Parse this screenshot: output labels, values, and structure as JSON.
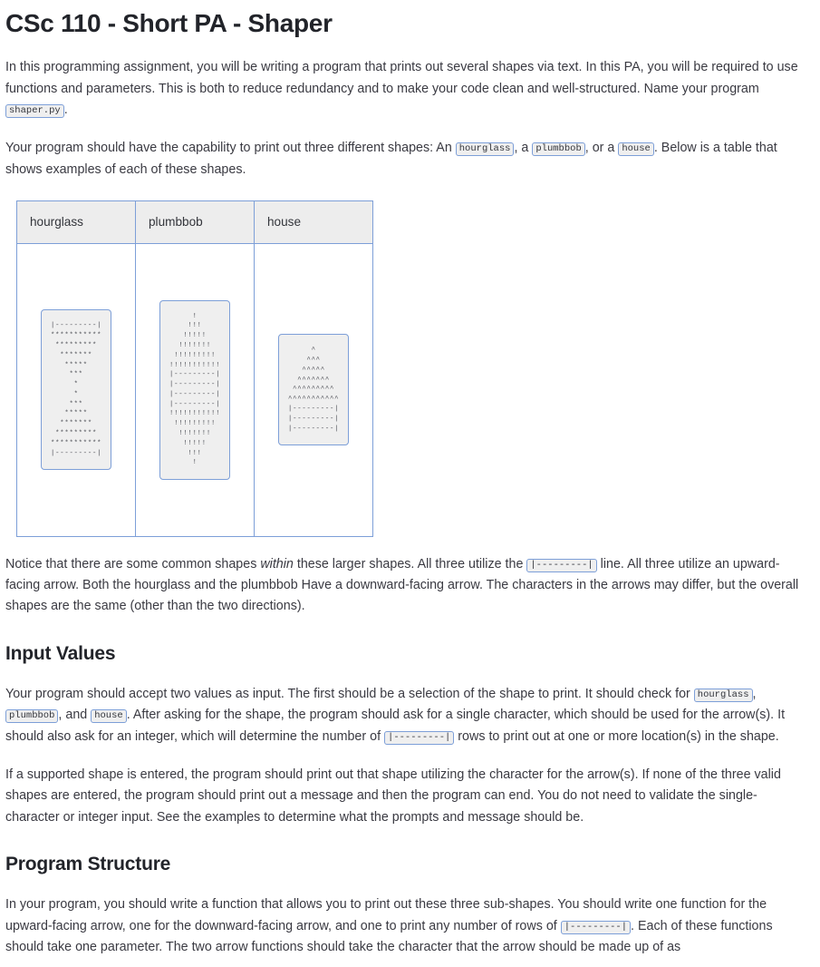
{
  "document": {
    "title": "CSc 110 - Short PA - Shaper"
  },
  "intro": {
    "p1_a": "In this programming assignment, you will be writing a program that prints out several shapes via text. In this PA, you will be required to use functions and parameters. This is both to reduce redundancy and to make your code clean and well-structured. Name your program ",
    "p1_code": "shaper.py",
    "p1_b": ".",
    "p2_a": "Your program should have the capability to print out three different shapes: An ",
    "p2_code1": "hourglass",
    "p2_b": ", a ",
    "p2_code2": "plumbbob",
    "p2_c": ", or a ",
    "p2_code3": "house",
    "p2_d": ". Below is a table that shows examples of each of these shapes."
  },
  "table": {
    "headers": [
      "hourglass",
      "plumbbob",
      "house"
    ],
    "shapes": {
      "hourglass": "|---------|\n***********\n *********\n  *******\n   *****\n    ***\n     *\n     *\n    ***\n   *****\n  *******\n *********\n***********\n|---------|",
      "plumbbob": "     !\n    !!!\n   !!!!!\n  !!!!!!!\n !!!!!!!!!\n!!!!!!!!!!!\n|---------|\n|---------|\n|---------|\n|---------|\n!!!!!!!!!!!\n !!!!!!!!!\n  !!!!!!!\n   !!!!!\n    !!!\n     !",
      "house": "     ^\n    ^^^\n   ^^^^^\n  ^^^^^^^\n ^^^^^^^^^\n^^^^^^^^^^^\n|---------|\n|---------|\n|---------|"
    }
  },
  "notice": {
    "a": "Notice that there are some common shapes ",
    "italic": "within",
    "b": " these larger shapes. All three utilize the ",
    "code": "|---------|",
    "c": " line. All three utilize an upward-facing arrow. Both the hourglass and the plumbbob Have a downward-facing arrow. The characters in the arrows may differ, but the overall shapes are the same (other than the two directions)."
  },
  "input_values": {
    "heading": "Input Values",
    "p1_a": "Your program should accept two values as input. The first should be a selection of the shape to print. It should check for ",
    "p1_code1": "hourglass",
    "p1_b": ", ",
    "p1_code2": "plumbbob",
    "p1_c": ", and ",
    "p1_code3": "house",
    "p1_d": ". After asking for the shape, the program should ask for a single character, which should be used for the arrow(s). It should also ask for an integer, which will determine the number of ",
    "p1_code4": "|---------|",
    "p1_e": " rows to print out at one or more location(s) in the shape.",
    "p2": "If a supported shape is entered, the program should print out that shape utilizing the character for the arrow(s). If none of the three valid shapes are entered, the program should print out a message and then the program can end. You do not need to validate the single-character or integer input. See the examples to determine what the prompts and message should be."
  },
  "program_structure": {
    "heading": "Program Structure",
    "p1_a": "In your program, you should write a function that allows you to print out these three sub-shapes. You should write one function for the upward-facing arrow, one for the downward-facing arrow, and one to print any number of rows of ",
    "p1_code": "|---------|",
    "p1_b": ". Each of these functions should take one parameter. The two arrow functions should take the character that the arrow should be made up of as"
  },
  "colors": {
    "accent_border": "#7d9fd8",
    "code_bg": "#efefef",
    "header_bg": "#ededed",
    "text": "#3a3a42"
  }
}
